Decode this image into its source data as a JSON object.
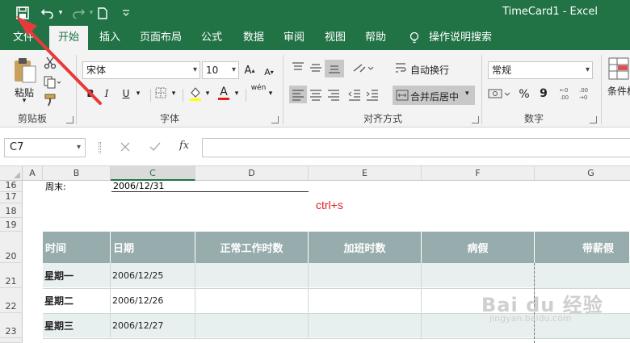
{
  "title_bar": {
    "doc_title": "TimeCard1  -  Excel",
    "qa_icons": [
      "save-icon",
      "undo-icon",
      "redo-icon",
      "new-icon",
      "customize-icon"
    ]
  },
  "tabs": [
    {
      "label": "文件",
      "active": false
    },
    {
      "label": "开始",
      "active": true
    },
    {
      "label": "插入",
      "active": false
    },
    {
      "label": "页面布局",
      "active": false
    },
    {
      "label": "公式",
      "active": false
    },
    {
      "label": "数据",
      "active": false
    },
    {
      "label": "审阅",
      "active": false
    },
    {
      "label": "视图",
      "active": false
    },
    {
      "label": "帮助",
      "active": false
    }
  ],
  "tell_me": "操作说明搜索",
  "ribbon": {
    "clipboard": {
      "paste": "粘贴",
      "group": "剪贴板"
    },
    "font": {
      "name": "宋体",
      "size": "10",
      "group": "字体",
      "bold": "B",
      "italic": "I",
      "underline": "U",
      "font_color_glyph": "A",
      "phonetic": "wén"
    },
    "alignment": {
      "wrap": "自动换行",
      "merge": "合并后居中",
      "group": "对齐方式"
    },
    "number": {
      "format": "常规",
      "percent": "%",
      "comma": "9",
      "group": "数字"
    },
    "styles": {
      "conditional": "条件格"
    }
  },
  "formula_bar": {
    "name_box": "C7",
    "fx": "fx",
    "formula": ""
  },
  "colors": {
    "excel_green": "#217346",
    "header_fill": "#97acad",
    "band_fill": "#e8efef",
    "annotation": "#e02020"
  },
  "columns": [
    "A",
    "B",
    "C",
    "D",
    "E",
    "F",
    "G"
  ],
  "rows": [
    "16",
    "17",
    "18",
    "19",
    "20",
    "21",
    "22",
    "23"
  ],
  "sheet": {
    "week_end_label": "周末:",
    "week_end_value": "2006/12/31",
    "annotation": "ctrl+s",
    "headers": [
      "时间",
      "日期",
      "正常工作时数",
      "加班时数",
      "病假",
      "带薪假"
    ],
    "data_rows": [
      {
        "day": "星期一",
        "date": "2006/12/25"
      },
      {
        "day": "星期二",
        "date": "2006/12/26"
      },
      {
        "day": "星期三",
        "date": "2006/12/27"
      }
    ]
  },
  "watermark": {
    "brand": "Bai du 经验",
    "url": "jingyan.baidu.com"
  }
}
